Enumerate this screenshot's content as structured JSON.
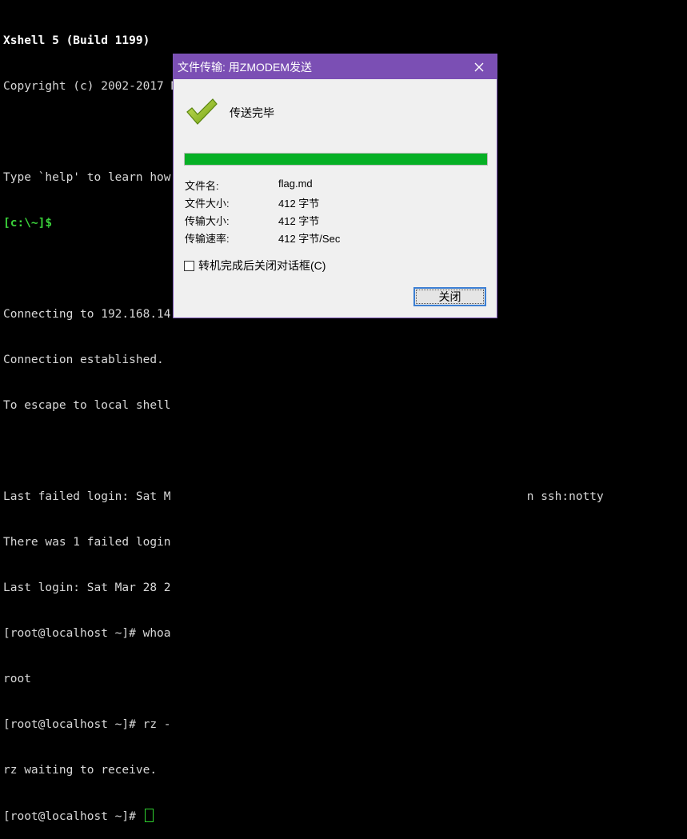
{
  "terminal": {
    "lines": [
      {
        "text": "Xshell 5 (Build 1199)",
        "style": "bold"
      },
      {
        "text": "Copyright (c) 2002-2017 NetSarang Computer, Inc. All rights reserved.",
        "style": "normal"
      },
      {
        "text": "",
        "style": "normal"
      },
      {
        "text": "Type `help' to learn how to use Xshell prompt.",
        "style": "normal"
      },
      {
        "text": "[c:\\~]$",
        "style": "prompt"
      },
      {
        "text": "",
        "style": "normal"
      },
      {
        "text": "Connecting to 192.168.14",
        "style": "normal"
      },
      {
        "text": "Connection established.",
        "style": "normal"
      },
      {
        "text": "To escape to local shell",
        "style": "normal"
      },
      {
        "text": "",
        "style": "normal"
      },
      {
        "text": "Last failed login: Sat M                                                   n ssh:notty",
        "style": "normal"
      },
      {
        "text": "There was 1 failed login",
        "style": "normal"
      },
      {
        "text": "Last login: Sat Mar 28 2",
        "style": "normal"
      },
      {
        "text": "[root@localhost ~]# whoa",
        "style": "normal"
      },
      {
        "text": "root",
        "style": "normal"
      },
      {
        "text": "[root@localhost ~]# rz -",
        "style": "normal"
      },
      {
        "text": "rz waiting to receive.",
        "style": "normal"
      },
      {
        "text": "[root@localhost ~]# ",
        "style": "cursor"
      }
    ]
  },
  "dialog": {
    "title": "文件传输: 用ZMODEM发送",
    "status": "传送完毕",
    "progress": 1.0,
    "info": [
      {
        "label": "文件名:",
        "value": "flag.md"
      },
      {
        "label": "文件大小:",
        "value": "412 字节"
      },
      {
        "label": "传输大小:",
        "value": "412 字节"
      },
      {
        "label": "传输速率:",
        "value": "412 字节/Sec"
      }
    ],
    "checkbox_label": "转机完成后关闭对话框(C)",
    "checkbox_checked": false,
    "close_button_label": "关闭"
  }
}
